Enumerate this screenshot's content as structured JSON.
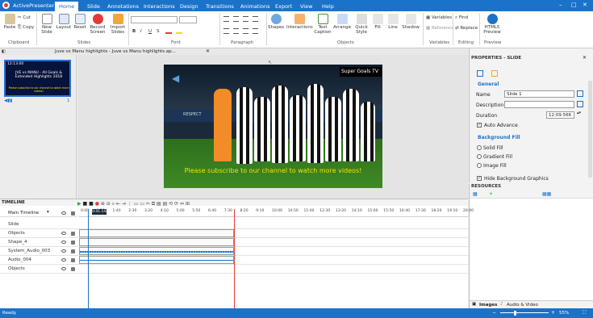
{
  "app": {
    "name": "ActivePresenter"
  },
  "tabs": [
    "Home",
    "Slide",
    "Annotations",
    "Interactions",
    "Design",
    "Transitions",
    "Animations",
    "Export",
    "View",
    "Help"
  ],
  "active_tab": "Home",
  "ribbon": {
    "clipboard": {
      "paste": "Paste",
      "cut": "Cut",
      "copy": "Copy",
      "label": "Clipboard"
    },
    "slides": {
      "new_slide": "New Slide",
      "layout": "Layout",
      "reset": "Reset",
      "record_screen": "Record Screen",
      "import_slides": "Import Slides",
      "label": "Slides"
    },
    "font": {
      "label": "Font",
      "bold": "B",
      "italic": "I",
      "underline": "U",
      "strike": "S"
    },
    "paragraph": {
      "label": "Paragraph"
    },
    "objects": {
      "shapes": "Shapes",
      "interactions": "Interactions",
      "text_caption": "Text Caption",
      "arrange": "Arrange",
      "quick_style": "Quick Style",
      "fill": "Fill",
      "line": "Line",
      "shadow": "Shadow",
      "label": "Objects"
    },
    "variables": {
      "variables": "Variables",
      "reference": "Reference",
      "label": "Variables"
    },
    "editing": {
      "find": "Find",
      "replace": "Replace",
      "label": "Editing"
    },
    "preview": {
      "html5": "HTML5 Preview",
      "label": "Preview"
    }
  },
  "document_tab": {
    "title": "Juve vs Manu highlights - Juve vs Manu highlights.ap..."
  },
  "thumbnail": {
    "time": "12:13:00",
    "title": "JVE vs MANU - All Goals & Extended Highlights 2018",
    "subtitle": "Please subscribe to our channel to watch more videos!",
    "number": "1"
  },
  "slide": {
    "badge": "Super Goals TV",
    "caption": "Please subscribe to our channel to watch more videos!",
    "board_text": "RESPECT"
  },
  "properties": {
    "title": "PROPERTIES - SLIDE",
    "general": "General",
    "name_label": "Name",
    "name_value": "Slide 1",
    "description_label": "Description",
    "description_value": "",
    "duration_label": "Duration",
    "duration_value": "12:09.566",
    "auto_advance": "Auto Advance",
    "background_fill": "Background Fill",
    "solid_fill": "Solid Fill",
    "gradient_fill": "Gradient Fill",
    "image_fill": "Image Fill",
    "hide_bg_graphics": "Hide Background Graphics"
  },
  "resources": {
    "title": "RESOURCES",
    "tab_images": "Images",
    "tab_audio_video": "Audio & Video"
  },
  "timeline": {
    "title": "TIMELINE",
    "main_timeline": "Main Timeline",
    "playhead": "0:41.144",
    "ruler": [
      "0:00",
      "0:50",
      "1:40",
      "2:30",
      "3:20",
      "4:10",
      "5:00",
      "5:50",
      "6:40",
      "7:30",
      "8:20",
      "9:10",
      "10:00",
      "10:50",
      "11:40",
      "12:30",
      "13:20",
      "14:10",
      "15:00",
      "15:50",
      "16:40",
      "17:30",
      "18:20",
      "19:10",
      "20:00"
    ],
    "tracks": [
      "Slide",
      "Objects",
      "Shape_4",
      "System_Audio_003",
      "Audio_004",
      "Objects"
    ]
  },
  "status": {
    "text": "Ready",
    "zoom": "55%"
  },
  "colors": {
    "accent": "#1a73c9",
    "caption_yellow": "#f4e200",
    "playhead": "#e53935"
  }
}
